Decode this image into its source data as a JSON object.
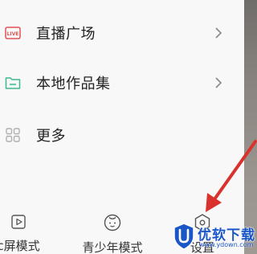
{
  "menu": {
    "items": [
      {
        "icon": "live-icon",
        "label": "直播广场",
        "accent": "#e05252"
      },
      {
        "icon": "folder-icon",
        "label": "本地作品集",
        "accent": "#3cb98d"
      },
      {
        "icon": "grid-icon",
        "label": "更多",
        "accent": "#b0b0b0"
      }
    ]
  },
  "bottom_nav": {
    "items": [
      {
        "icon": "play-square-icon",
        "label": "c屏模式"
      },
      {
        "icon": "face-icon",
        "label": "青少年模式"
      },
      {
        "icon": "settings-hexagon-icon",
        "label": "设置"
      }
    ]
  },
  "annotation": {
    "arrow_color": "#d9312b"
  },
  "watermark": {
    "brand": "优软下载",
    "url": "www.ydown.com",
    "color": "#1a56c8"
  }
}
